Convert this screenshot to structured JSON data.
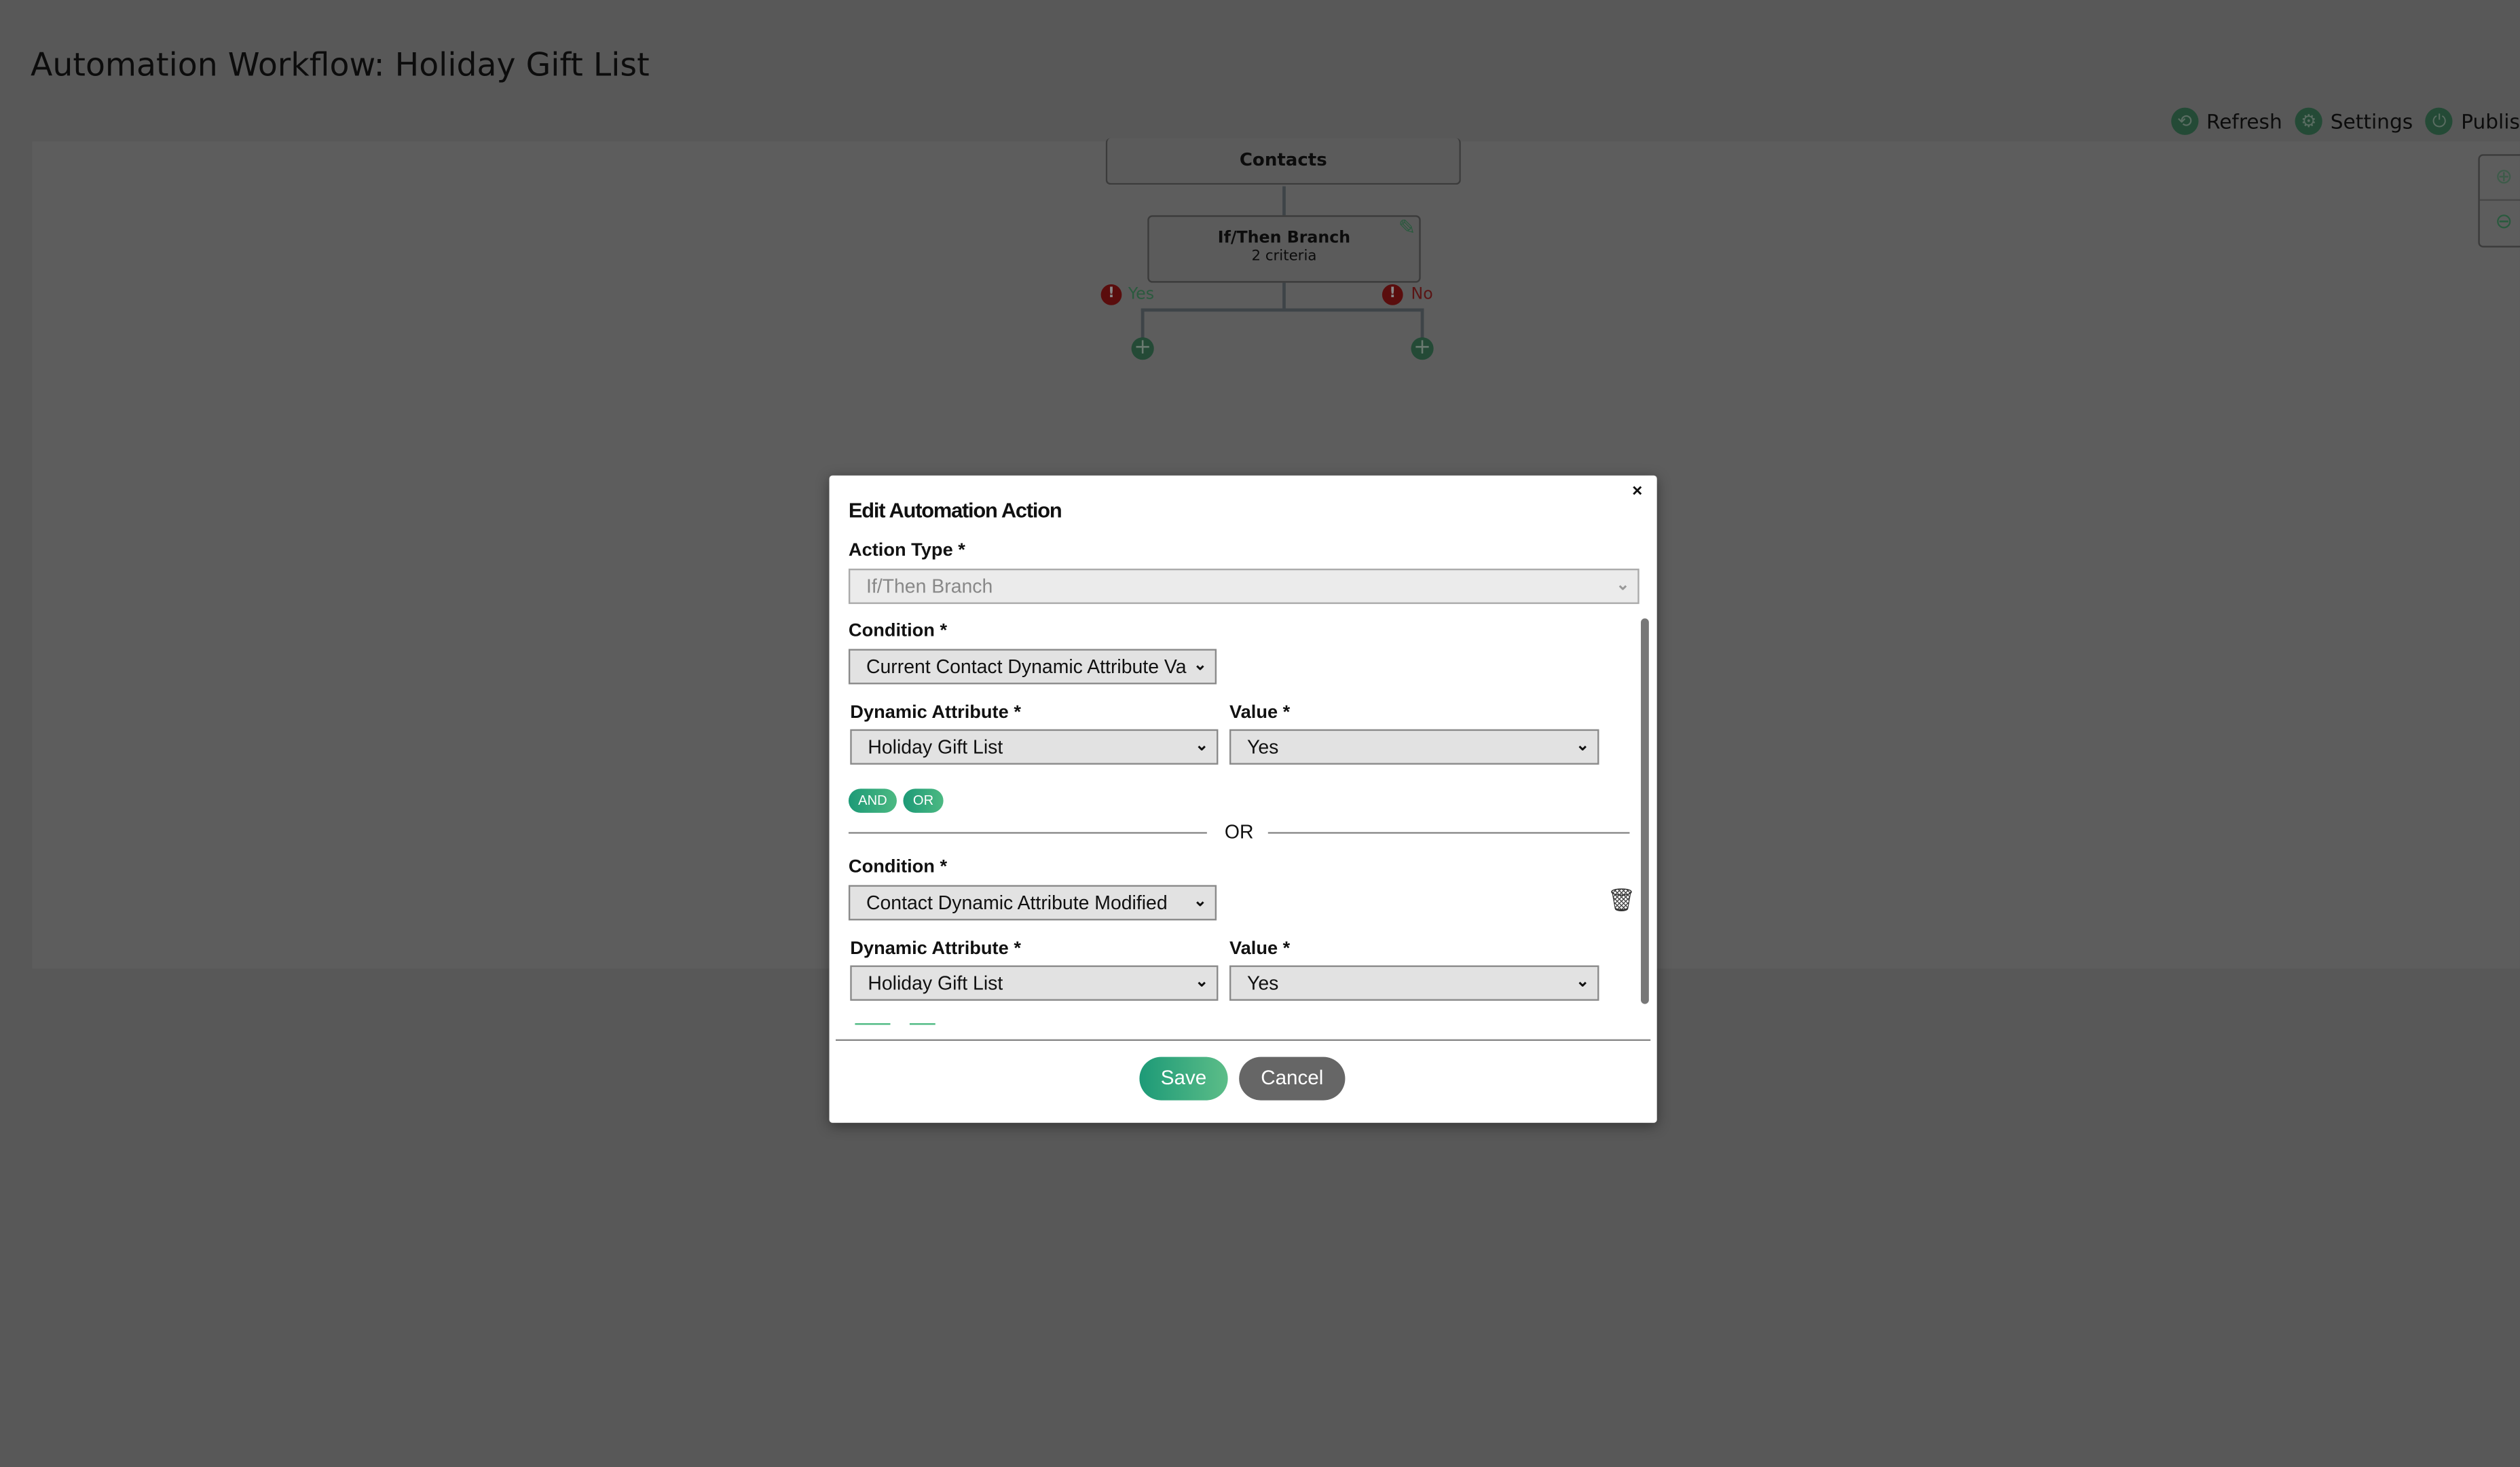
{
  "page": {
    "title": "Automation Workflow: Holiday Gift List"
  },
  "toolbar": {
    "items": [
      {
        "label": "Refresh",
        "icon": "refresh-icon"
      },
      {
        "label": "Settings",
        "icon": "gear-icon"
      },
      {
        "label": "Publis",
        "icon": "power-icon"
      }
    ]
  },
  "workflow": {
    "contacts_label": "Contacts",
    "branch": {
      "title": "If/Then Branch",
      "subtitle": "2 criteria"
    },
    "yes_label": "Yes",
    "no_label": "No"
  },
  "colors": {
    "accent": "#1d9a77",
    "cancel": "#666666",
    "overlay": "#585858"
  },
  "modal": {
    "title": "Edit Automation Action",
    "close": "×",
    "action_type_label": "Action Type *",
    "action_type_value": "If/Then Branch",
    "criteria": [
      {
        "condition_label": "Condition *",
        "condition_value": "Current Contact Dynamic Attribute Va",
        "attr_label": "Dynamic Attribute *",
        "attr_value": "Holiday Gift List",
        "value_label": "Value *",
        "value_value": "Yes"
      },
      {
        "condition_label": "Condition *",
        "condition_value": "Contact Dynamic Attribute Modified",
        "attr_label": "Dynamic Attribute *",
        "attr_value": "Holiday Gift List",
        "value_label": "Value *",
        "value_value": "Yes"
      }
    ],
    "and_label": "AND",
    "or_label": "OR",
    "separator": "OR",
    "save": "Save",
    "cancel": "Cancel"
  }
}
